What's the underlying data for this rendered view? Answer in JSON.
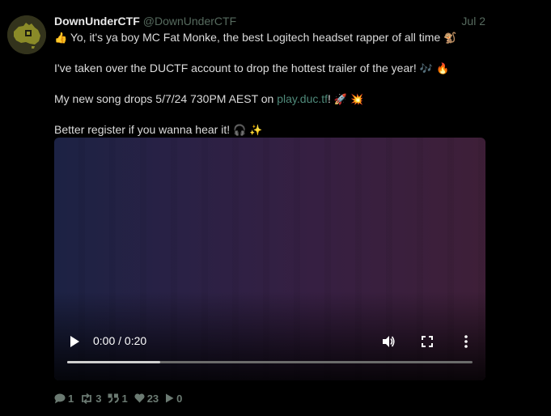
{
  "post": {
    "display_name": "DownUnderCTF",
    "handle": "@DownUnderCTF",
    "date": "Jul 2",
    "lines": [
      {
        "text": "Yo, it's ya boy MC Fat Monke, the best Logitech headset rapper of all time",
        "lead_emoji": "👍",
        "trail_emoji": "🐒"
      },
      {
        "text": "I've taken over the DUCTF account to drop the hottest trailer of the year!",
        "trail_emoji": "🎶 🔥"
      },
      {
        "before": "My new song drops 5/7/24 730PM AEST on ",
        "link": "play.duc.tf",
        "after": "!",
        "trail_emoji": "🚀 💥"
      },
      {
        "text": "Better register if you wanna hear it!",
        "trail_emoji": "🎧 ✨"
      }
    ]
  },
  "video": {
    "current_time": "0:00",
    "separator": "/",
    "duration": "0:20",
    "time_label": "0:00 / 0:20",
    "progress_fraction": 0.23
  },
  "actions": {
    "replies": "1",
    "boosts": "3",
    "quotes": "1",
    "likes": "23",
    "plays": "0"
  },
  "colors": {
    "background": "#000000",
    "handle": "#566a5e",
    "link": "#4f8a7a",
    "action": "#6b7a72"
  },
  "icons": [
    "avatar-australia-map",
    "play-icon",
    "volume-icon",
    "fullscreen-icon",
    "more-options-icon",
    "reply-icon",
    "boost-icon",
    "quote-icon",
    "heart-icon",
    "play-count-icon"
  ]
}
